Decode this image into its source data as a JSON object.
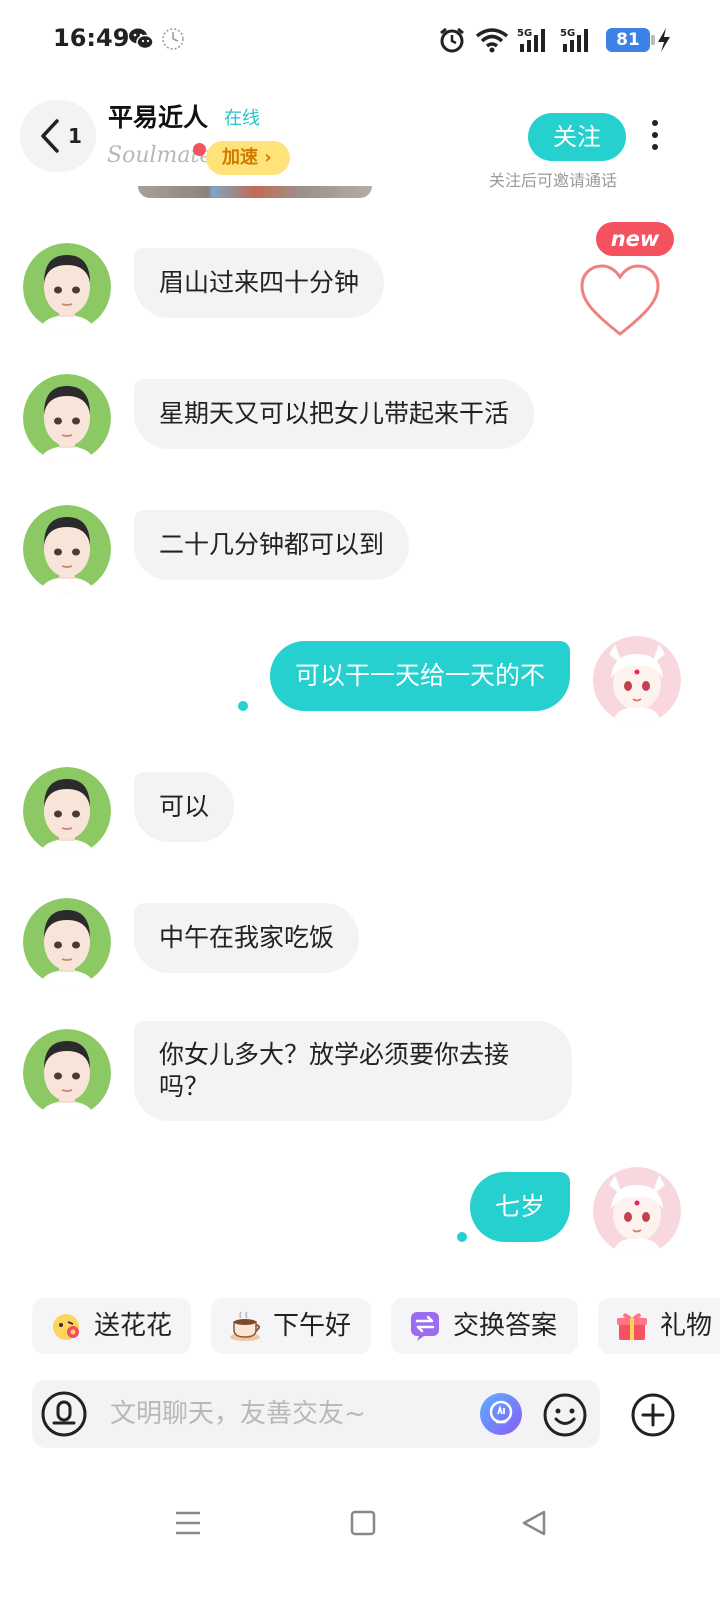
{
  "status_bar": {
    "time": "16:49",
    "network_1": "5G",
    "network_2": "5G",
    "battery": "81"
  },
  "header": {
    "back_count": "1",
    "name": "平易近人",
    "status": "在线",
    "app_logo": "Soulmate",
    "speed_label": "加速 ›",
    "follow_label": "关注",
    "follow_hint": "关注后可邀请通话"
  },
  "heart_widget": {
    "badge": "new"
  },
  "messages": [
    {
      "side": "in",
      "text": "眉山过来四十分钟"
    },
    {
      "side": "in",
      "text": "星期天又可以把女儿带起来干活"
    },
    {
      "side": "in",
      "text": "二十几分钟都可以到"
    },
    {
      "side": "out",
      "text": "可以干一天给一天的不"
    },
    {
      "side": "in",
      "text": "可以"
    },
    {
      "side": "in",
      "text": "中午在我家吃饭"
    },
    {
      "side": "in",
      "text": "你女儿多大？放学必须要你去接吗？"
    },
    {
      "side": "out",
      "text": "七岁"
    }
  ],
  "quick_replies": [
    {
      "label": "送花花",
      "icon": "flower-emoji-icon"
    },
    {
      "label": "下午好",
      "icon": "coffee-icon"
    },
    {
      "label": "交换答案",
      "icon": "exchange-icon"
    },
    {
      "label": "礼物",
      "icon": "gift-icon"
    }
  ],
  "input": {
    "placeholder": "文明聊天，友善交友~"
  },
  "colors": {
    "accent": "#26d0cf",
    "incoming_bubble": "#f3f3f5",
    "badge_red": "#f4525f"
  }
}
